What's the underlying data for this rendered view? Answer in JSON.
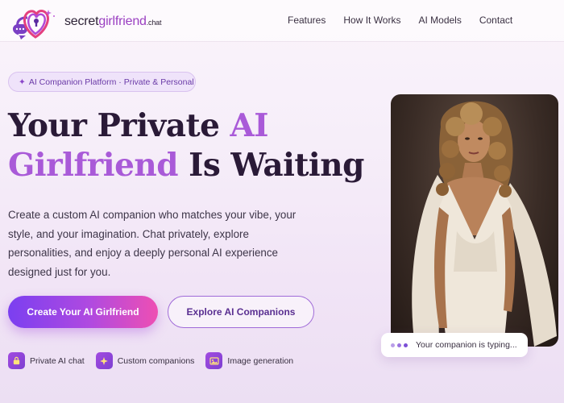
{
  "brand": {
    "name_part1": "secret",
    "name_part2": "girlfriend",
    "name_part3": ".chat",
    "accent_color": "#9a3fc1"
  },
  "nav": {
    "items": [
      {
        "label": "Features"
      },
      {
        "label": "How It Works"
      },
      {
        "label": "AI Models"
      },
      {
        "label": "Contact"
      }
    ]
  },
  "hero": {
    "badge": "AI Companion Platform · Private & Personal",
    "badge_icon": "sparkle-icon",
    "title_line1_a": "Your Private ",
    "title_line1_b": "AI",
    "title_line2_a": "Girlfriend",
    "title_line2_b": " Is Waiting",
    "description": "Create a custom AI companion who matches your vibe, your style, and your imagination. Chat privately, explore personalities, and enjoy a deeply personal AI experience designed just for you.",
    "primary_cta": "Create Your AI Girlfriend",
    "secondary_cta": "Explore AI Companions"
  },
  "features": [
    {
      "label": "Private AI chat",
      "icon": "lock-icon"
    },
    {
      "label": "Custom companions",
      "icon": "sparkle-icon"
    },
    {
      "label": "Image generation",
      "icon": "image-icon"
    }
  ],
  "companion_card": {
    "typing_text": "Your companion is typing..."
  },
  "colors": {
    "primary_gradient_start": "#7b3ff0",
    "primary_gradient_end": "#ee4fb3",
    "accent_purple": "#a95ad8"
  }
}
